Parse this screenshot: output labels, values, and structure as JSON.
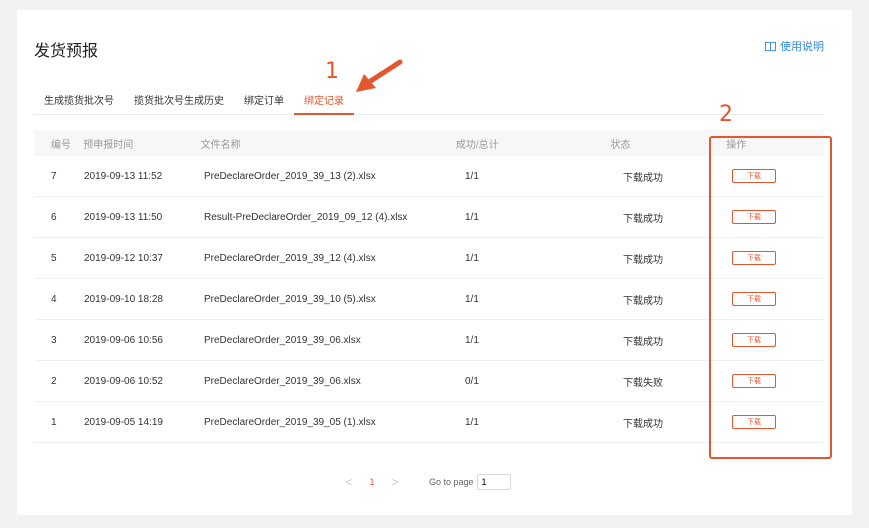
{
  "page": {
    "title": "发货预报",
    "help_link": "使用说明"
  },
  "tabs": [
    {
      "label": "生成揽货批次号"
    },
    {
      "label": "揽货批次号生成历史"
    },
    {
      "label": "绑定订单"
    },
    {
      "label": "绑定记录",
      "active": true
    }
  ],
  "annotations": {
    "one": "1",
    "two": "2",
    "color": "#e4572e"
  },
  "table": {
    "headers": [
      "编号",
      "预申报时间",
      "文件名称",
      "成功/总计",
      "状态",
      "操作"
    ],
    "rows": [
      {
        "id": "7",
        "time": "2019-09-13 11:52",
        "file": "PreDeclareOrder_2019_39_13 (2).xlsx",
        "ratio": "1/1",
        "status": "下载成功",
        "action": "下载"
      },
      {
        "id": "6",
        "time": "2019-09-13 11:50",
        "file": "Result-PreDeclareOrder_2019_09_12 (4).xlsx",
        "ratio": "1/1",
        "status": "下载成功",
        "action": "下载"
      },
      {
        "id": "5",
        "time": "2019-09-12 10:37",
        "file": "PreDeclareOrder_2019_39_12 (4).xlsx",
        "ratio": "1/1",
        "status": "下载成功",
        "action": "下载"
      },
      {
        "id": "4",
        "time": "2019-09-10 18:28",
        "file": "PreDeclareOrder_2019_39_10 (5).xlsx",
        "ratio": "1/1",
        "status": "下载成功",
        "action": "下载"
      },
      {
        "id": "3",
        "time": "2019-09-06 10:56",
        "file": "PreDeclareOrder_2019_39_06.xlsx",
        "ratio": "1/1",
        "status": "下载成功",
        "action": "下载"
      },
      {
        "id": "2",
        "time": "2019-09-06 10:52",
        "file": "PreDeclareOrder_2019_39_06.xlsx",
        "ratio": "0/1",
        "status": "下载失败",
        "action": "下载"
      },
      {
        "id": "1",
        "time": "2019-09-05 14:19",
        "file": "PreDeclareOrder_2019_39_05 (1).xlsx",
        "ratio": "1/1",
        "status": "下载成功",
        "action": "下载"
      }
    ]
  },
  "pagination": {
    "prev": "<",
    "current": "1",
    "next": ">",
    "goto_label": "Go to page",
    "goto_value": "1"
  }
}
